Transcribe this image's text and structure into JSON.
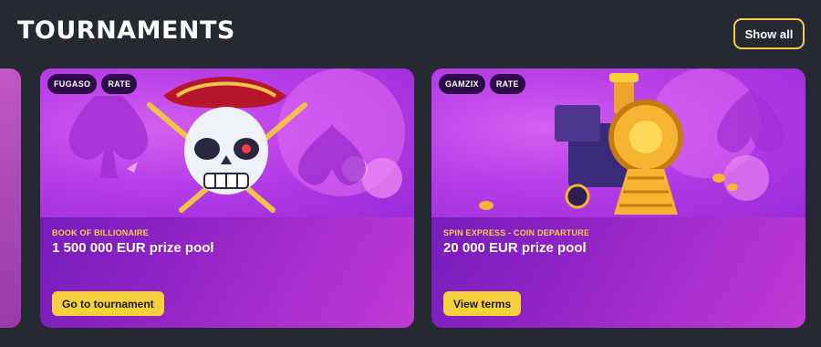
{
  "header": {
    "title": "TOURNAMENTS",
    "show_all_label": "Show all"
  },
  "cards": [
    {
      "tags": [
        "FUGASO",
        "RATE"
      ],
      "game_name": "BOOK OF BILLIONAIRE",
      "prize": "1 500 000 EUR prize pool",
      "cta_label": "Go to tournament",
      "art_icon": "pirate-skull-icon"
    },
    {
      "tags": [
        "GAMZIX",
        "RATE"
      ],
      "game_name": "SPIN EXPRESS - COIN DEPARTURE",
      "prize": "20 000 EUR prize pool",
      "cta_label": "View terms",
      "art_icon": "train-icon"
    }
  ],
  "colors": {
    "background": "#262932",
    "accent": "#f6cf3c",
    "card_gradient_start": "#6a19b6",
    "card_gradient_end": "#c13ad6",
    "tag_bg": "#2c0c46"
  }
}
